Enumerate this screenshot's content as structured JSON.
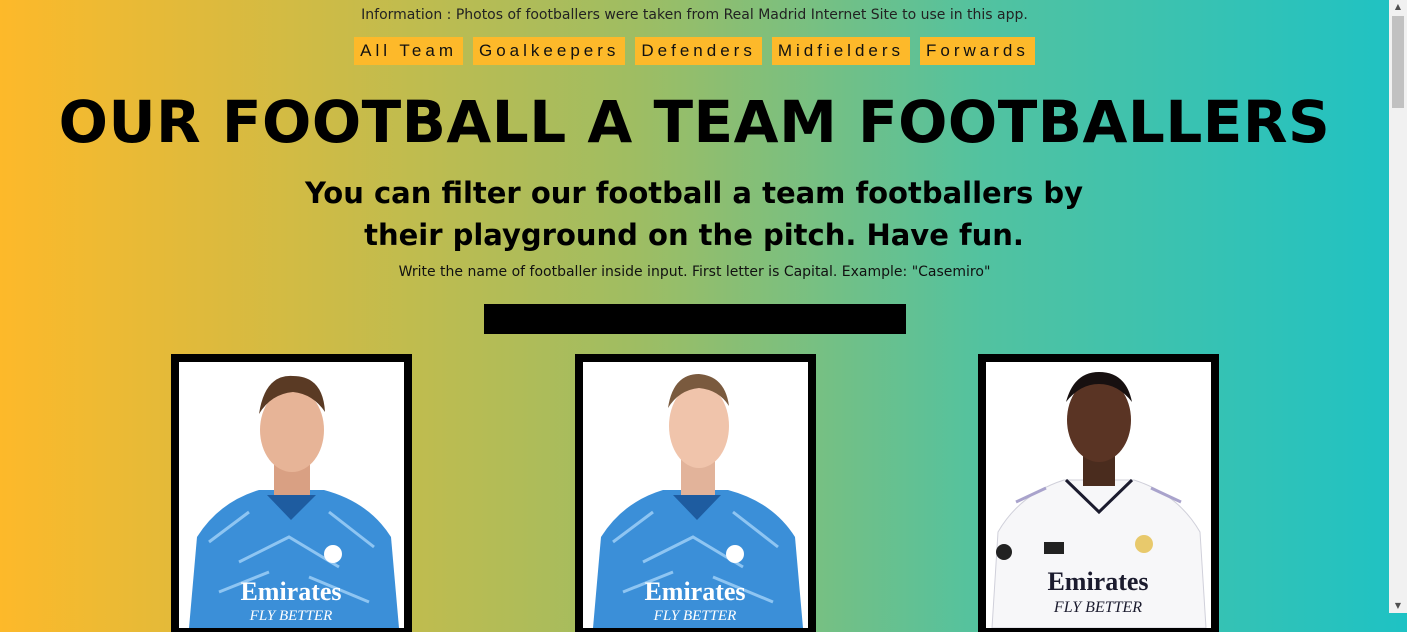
{
  "info_text": "Information : Photos of footballers were taken from Real Madrid Internet Site to use in this app.",
  "nav": [
    "All Team",
    "Goalkeepers",
    "Defenders",
    "Midfielders",
    "Forwards"
  ],
  "title": "OUR FOOTBALL A TEAM FOOTBALLERS",
  "subtitle": "You can filter our football a team footballers by their playground on the pitch. Have fun.",
  "hint": "Write the name of footballer inside input. First letter is Capital. Example: \"Casemiro\"",
  "search": {
    "value": "",
    "placeholder": ""
  },
  "cards": [
    {
      "kit": "blue",
      "brand": "Emirates",
      "slogan": "FLY BETTER"
    },
    {
      "kit": "blue",
      "brand": "Emirates",
      "slogan": "FLY BETTER"
    },
    {
      "kit": "white",
      "brand": "Emirates",
      "slogan": "FLY BETTER"
    }
  ],
  "colors": {
    "nav_bg": "#fdb92a",
    "gradient_left": "#fdb92a",
    "gradient_right": "#1ec2c4",
    "gk_kit": "#3b8fd8",
    "home_kit": "#ffffff"
  }
}
